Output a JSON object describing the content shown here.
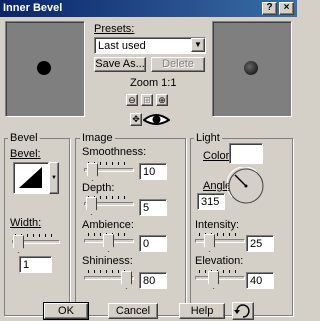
{
  "window": {
    "title": "Inner Bevel",
    "help_glyph": "?",
    "close_glyph": "×"
  },
  "presets": {
    "label": "Presets:",
    "value": "Last used",
    "save_as": "Save As...",
    "delete": "Delete"
  },
  "zoom": {
    "label": "Zoom 1:1"
  },
  "bevel_group": {
    "title": "Bevel",
    "bevel_label": "Bevel:",
    "width_label": "Width:",
    "width_value": "1"
  },
  "image_group": {
    "title": "Image",
    "smoothness": {
      "label": "Smoothness:",
      "value": "10"
    },
    "depth": {
      "label": "Depth:",
      "value": "5"
    },
    "ambience": {
      "label": "Ambience:",
      "value": "0"
    },
    "shininess": {
      "label": "Shininess:",
      "value": "80"
    }
  },
  "light_group": {
    "title": "Light",
    "color_label": "Color:",
    "angle": {
      "label": "Angle:",
      "value": "315"
    },
    "intensity": {
      "label": "Intensity:",
      "value": "25"
    },
    "elevation": {
      "label": "Elevation:",
      "value": "40"
    }
  },
  "buttons": {
    "ok": "OK",
    "cancel": "Cancel",
    "help": "Help"
  }
}
